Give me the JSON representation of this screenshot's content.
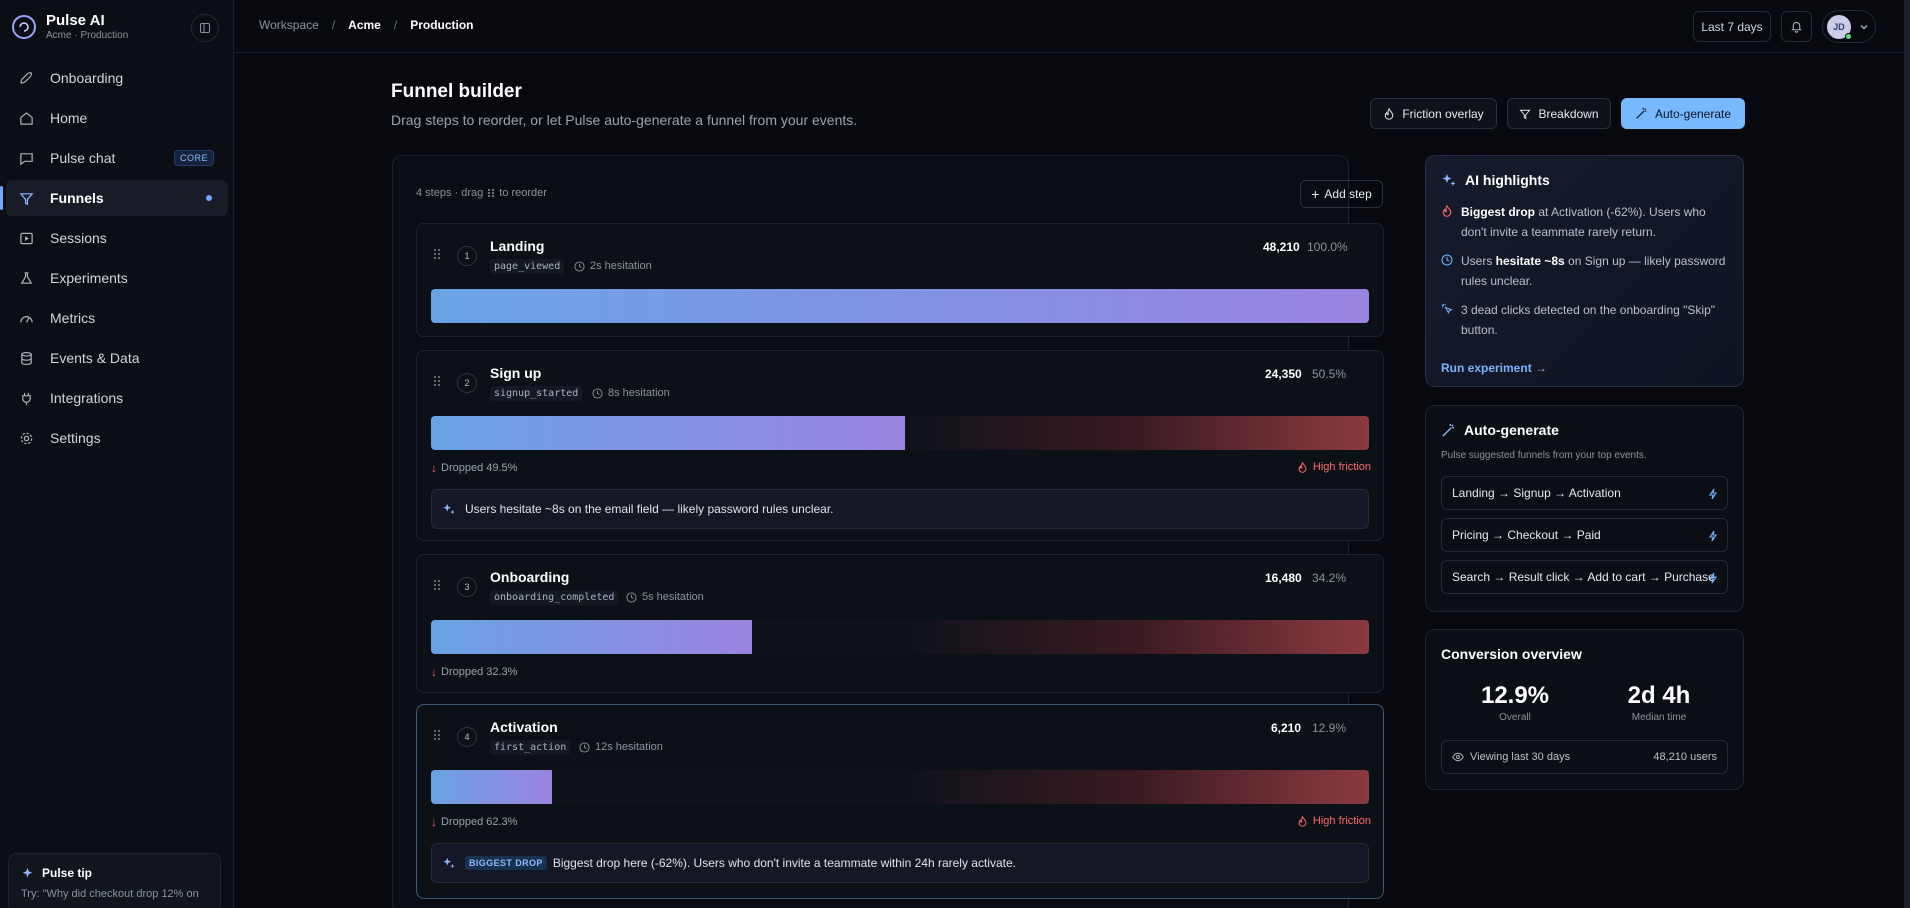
{
  "brand": {
    "name": "Pulse AI",
    "sub": "Acme · Production"
  },
  "sidebar": {
    "items": [
      {
        "label": "Onboarding",
        "icon": "rocket-icon"
      },
      {
        "label": "Home",
        "icon": "home-icon"
      },
      {
        "label": "Pulse chat",
        "icon": "chat-icon",
        "badge": "CORE"
      },
      {
        "label": "Funnels",
        "icon": "funnel-icon",
        "active": true
      },
      {
        "label": "Sessions",
        "icon": "play-icon"
      },
      {
        "label": "Experiments",
        "icon": "flask-icon"
      },
      {
        "label": "Metrics",
        "icon": "gauge-icon"
      },
      {
        "label": "Events & Data",
        "icon": "database-icon"
      },
      {
        "label": "Integrations",
        "icon": "plug-icon"
      },
      {
        "label": "Settings",
        "icon": "gear-icon"
      }
    ],
    "tip": {
      "title": "Pulse tip",
      "text": "Try: \"Why did checkout drop 12% on"
    }
  },
  "topbar": {
    "breadcrumb": [
      "Workspace",
      "Acme",
      "Production"
    ],
    "range": "Last 7 days",
    "avatar_initials": "JD"
  },
  "header": {
    "title": "Funnel builder",
    "subtitle": "Drag steps to reorder, or let Pulse auto-generate a funnel from your events.",
    "friction_label": "Friction overlay",
    "breakdown_label": "Breakdown",
    "autogen_label": "Auto-generate"
  },
  "funnel": {
    "meta_prefix": "4 steps · drag",
    "meta_suffix": "to reorder",
    "add_step": "Add step",
    "steps": [
      {
        "num": "1",
        "name": "Landing",
        "event": "page_viewed",
        "hesitation": "2s hesitation",
        "count": "48,210",
        "pct": "100.0%",
        "fraction": 1.0
      },
      {
        "num": "2",
        "name": "Sign up",
        "event": "signup_started",
        "hesitation": "8s hesitation",
        "count": "24,350",
        "pct": "50.5%",
        "fraction": 0.505,
        "dropped": "Dropped 49.5%",
        "friction": "High friction",
        "insight": "Users hesitate ~8s on the email field — likely password rules unclear."
      },
      {
        "num": "3",
        "name": "Onboarding",
        "event": "onboarding_completed",
        "hesitation": "5s hesitation",
        "count": "16,480",
        "pct": "34.2%",
        "fraction": 0.342,
        "dropped": "Dropped 32.3%"
      },
      {
        "num": "4",
        "name": "Activation",
        "event": "first_action",
        "hesitation": "12s hesitation",
        "count": "6,210",
        "pct": "12.9%",
        "fraction": 0.129,
        "dropped": "Dropped 62.3%",
        "friction": "High friction",
        "badge": "BIGGEST DROP",
        "insight": "Biggest drop here (-62%). Users who don't invite a teammate within 24h rarely activate."
      }
    ]
  },
  "highlights": {
    "title": "AI highlights",
    "items": [
      {
        "strong": "Biggest drop",
        "rest": " at Activation (-62%). Users who don't invite a teammate rarely return."
      },
      {
        "pre": "Users ",
        "strong": "hesitate ~8s",
        "rest": " on Sign up — likely password rules unclear."
      },
      {
        "rest": "3 dead clicks detected on the onboarding \"Skip\" button."
      }
    ],
    "cta": "Run experiment →"
  },
  "autogen": {
    "title": "Auto-generate",
    "subtitle": "Pulse suggested funnels from your top events.",
    "options": [
      "Landing → Signup → Activation",
      "Pricing → Checkout → Paid",
      "Search → Result click → Add to cart → Purchase"
    ]
  },
  "overview": {
    "title": "Conversion overview",
    "overall_value": "12.9%",
    "overall_label": "Overall",
    "median_value": "2d 4h",
    "median_label": "Median time",
    "viewing": "Viewing last 30 days",
    "users": "48,210 users"
  },
  "colors": {
    "accent": "#78b8ff",
    "danger": "#ff6a6a",
    "bar_start": "#6aa3e4",
    "bar_end": "#9b84e0"
  }
}
